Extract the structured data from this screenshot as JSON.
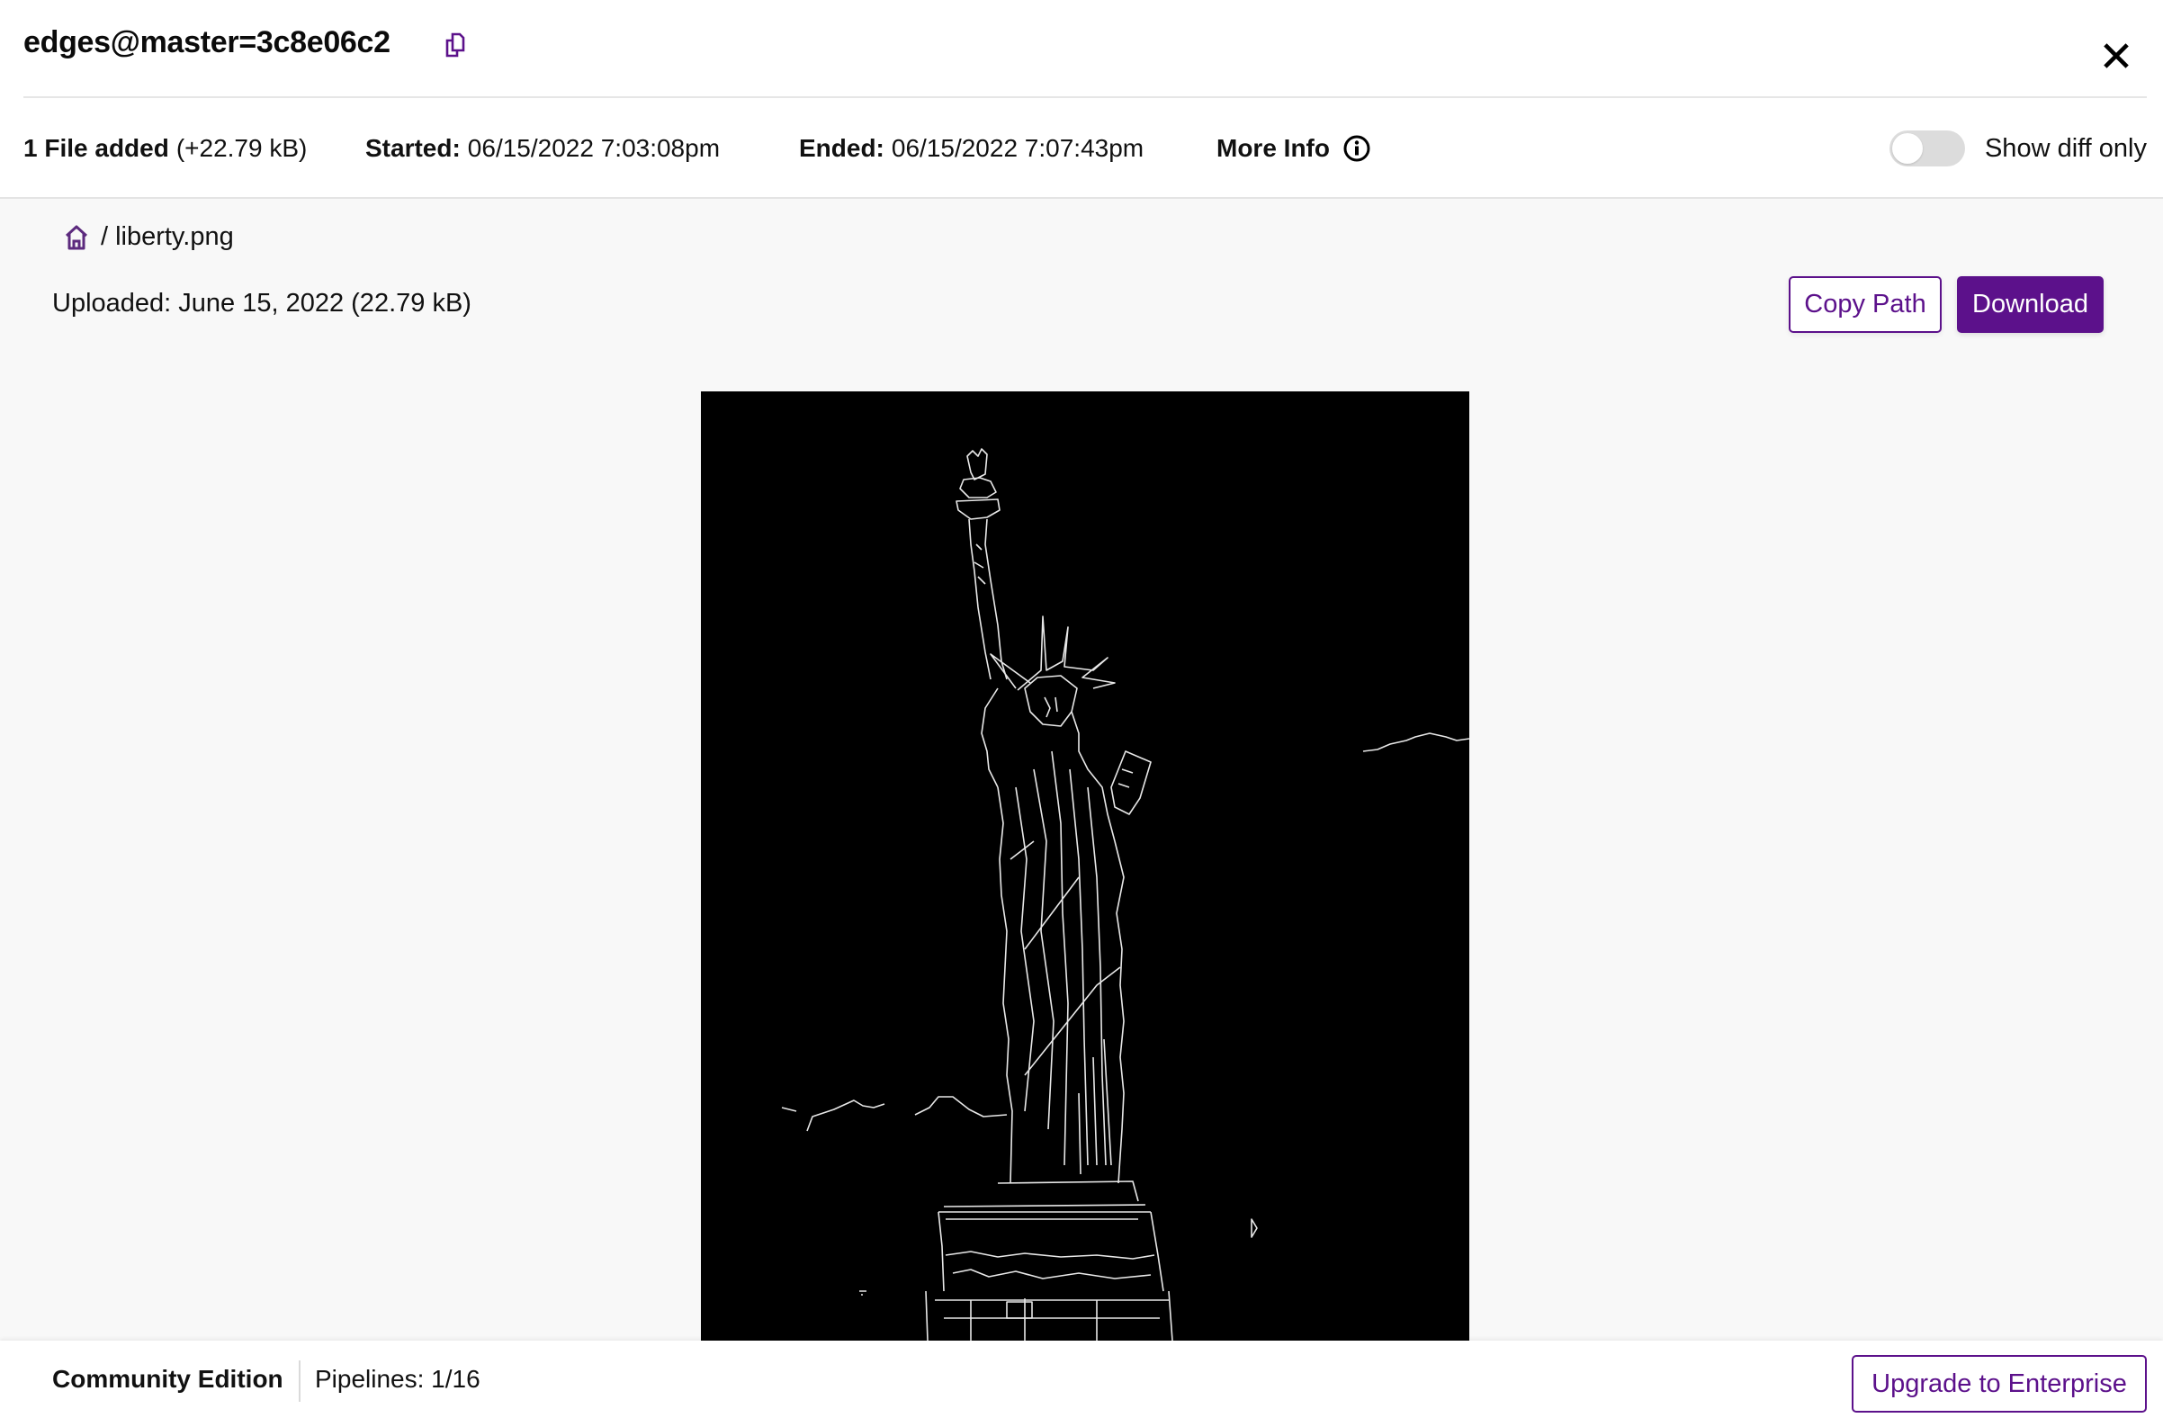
{
  "header": {
    "title": "edges@master=3c8e06c2",
    "copy_icon": "copy-icon",
    "close_icon": "close-icon"
  },
  "meta": {
    "files_added_label": "1 File added",
    "files_added_size": "(+22.79 kB)",
    "started_label": "Started:",
    "started_value": "06/15/2022 7:03:08pm",
    "ended_label": "Ended:",
    "ended_value": "06/15/2022 7:07:43pm",
    "more_info_label": "More Info",
    "more_info_icon": "info-icon",
    "show_diff_label": "Show diff only",
    "show_diff_enabled": false
  },
  "file": {
    "breadcrumb_home_icon": "home-icon",
    "breadcrumb_separator": "/",
    "filename": "liberty.png",
    "uploaded_text": "Uploaded: June 15, 2022 (22.79 kB)",
    "copy_path_label": "Copy Path",
    "download_label": "Download",
    "preview_alt": "Edge-detected image of the Statue of Liberty"
  },
  "footer": {
    "edition": "Community Edition",
    "pipelines": "Pipelines: 1/16",
    "upgrade_label": "Upgrade to Enterprise"
  },
  "colors": {
    "accent": "#5c118b",
    "toggle_off": "#dcdcdc",
    "content_bg": "#f8f8f8"
  }
}
